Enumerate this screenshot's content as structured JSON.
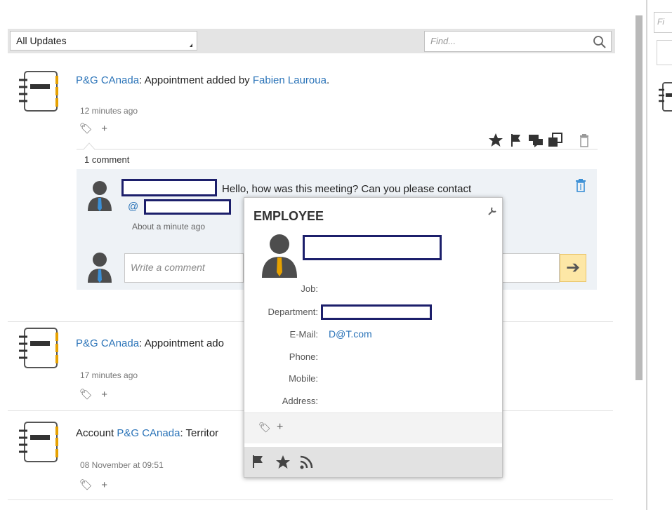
{
  "filter": {
    "selected": "All Updates",
    "search_placeholder": "Find..."
  },
  "feed": {
    "items": [
      {
        "account": "P&G CAnada",
        "text": ": Appointment added by ",
        "author": "Fabien Lauroua",
        "author_suffix": ".",
        "time": "12 minutes ago",
        "comment_count": "1 comment",
        "comment": {
          "text": "Hello, how was this meeting? Can you please contact",
          "mention_prefix": "@",
          "time": "About a minute ago"
        },
        "write_placeholder": "Write a comment"
      },
      {
        "account": "P&G CAnada",
        "text": ": Appointment ado",
        "time": "17 minutes ago"
      },
      {
        "prefix": "Account ",
        "account": "P&G CAnada",
        "text": ": Territor",
        "time": "08 November at 09:51"
      }
    ]
  },
  "popup": {
    "title": "EMPLOYEE",
    "labels": {
      "job": "Job:",
      "department": "Department:",
      "email": "E-Mail:",
      "phone": "Phone:",
      "mobile": "Mobile:",
      "address": "Address:"
    },
    "email_value": "D@T.com"
  },
  "right_pane": {
    "search_placeholder": "Fi"
  },
  "colors": {
    "link": "#2a73b8",
    "accent_yellow": "#e6a100",
    "redaction_border": "#1c1f6b"
  }
}
